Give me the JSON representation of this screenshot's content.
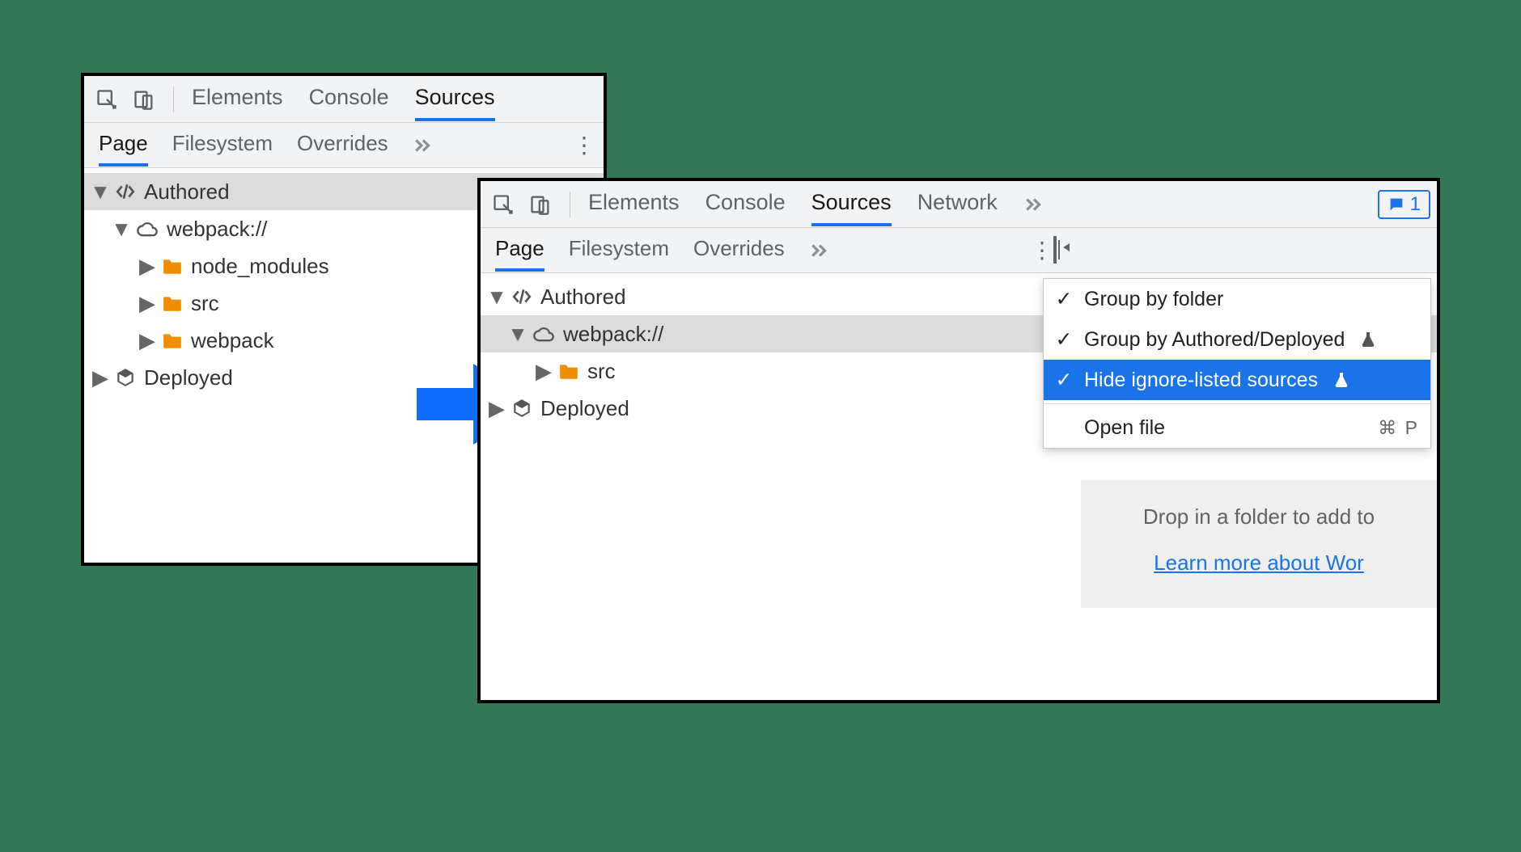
{
  "left_panel": {
    "main_tabs": {
      "elements": "Elements",
      "console": "Console",
      "sources": "Sources"
    },
    "sub_tabs": {
      "page": "Page",
      "filesystem": "Filesystem",
      "overrides": "Overrides"
    },
    "tree": {
      "authored": "Authored",
      "webpack": "webpack://",
      "node_modules": "node_modules",
      "src": "src",
      "webpack_folder": "webpack",
      "deployed": "Deployed"
    }
  },
  "right_panel": {
    "main_tabs": {
      "elements": "Elements",
      "console": "Console",
      "sources": "Sources",
      "network": "Network"
    },
    "sub_tabs": {
      "page": "Page",
      "filesystem": "Filesystem",
      "overrides": "Overrides"
    },
    "issues_count": "1",
    "tree": {
      "authored": "Authored",
      "webpack": "webpack://",
      "src": "src",
      "deployed": "Deployed"
    },
    "ctx_menu": {
      "group_by_folder": "Group by folder",
      "group_by_authored_deployed": "Group by Authored/Deployed",
      "hide_ignore_listed": "Hide ignore-listed sources",
      "open_file": "Open file",
      "open_file_shortcut": "⌘ P"
    },
    "workspace_hint": {
      "line1": "Drop in a folder to add to",
      "link": "Learn more about Wor"
    }
  }
}
